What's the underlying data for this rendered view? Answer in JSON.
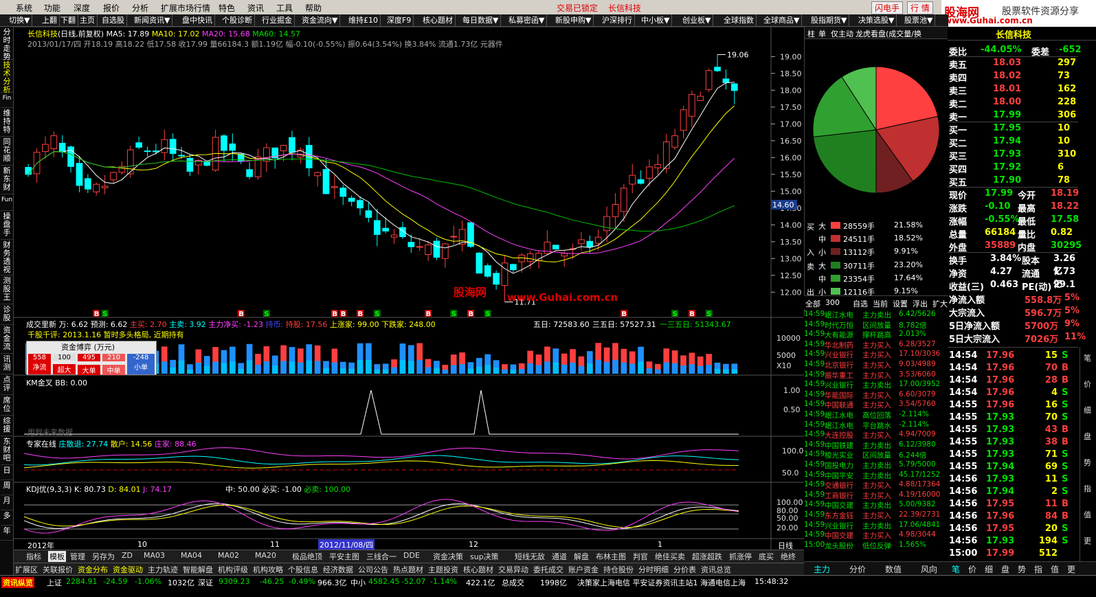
{
  "menu": [
    "系统",
    "功能",
    "深度",
    "报价",
    "分析",
    "扩展市场行情",
    "特色",
    "资讯",
    "工具",
    "帮助"
  ],
  "menu_status": "交易已锁定",
  "menu_stock": "长信科技",
  "menu_right": [
    "闪电手",
    "行 情"
  ],
  "logo": {
    "name": "股海网",
    "slogan": "股票软件资源分享",
    "url": "www.Guhai.com.cn"
  },
  "toolbar": [
    "切换▼",
    "上翻",
    "下翻",
    "主页",
    "自选股",
    "新闻资讯▼",
    "盘中快讯",
    "个股诊断",
    "行业掘金",
    "资金流向▼",
    "维持£10",
    "深度F9",
    "核心题材",
    "每日数据▼",
    "私募密函▼",
    "新股申购▼",
    "沪深排行",
    "中小板▼",
    "创业板▼",
    "全球指数",
    "全球商品▼",
    "股指期货▼",
    "决策选股▼",
    "股票池▼"
  ],
  "left_tabs": [
    "分时走势",
    "技术分析",
    "维持特",
    "同花顺",
    "新东财",
    "操盘手",
    "财务透视",
    "测股王",
    "诊股",
    "资金流",
    "讯测",
    "点评",
    "席位",
    "综援",
    "东财吧",
    "日",
    "周",
    "月",
    "多",
    "年"
  ],
  "left_icons": [
    "Fin",
    "Fun",
    "Fiz",
    "RSI"
  ],
  "chart_header": {
    "name": "长信科技",
    "period": "(日线,前复权)",
    "ma5": "MA5: 17.89",
    "ma10": "MA10: 17.02",
    "ma20": "MA20: 15.68",
    "ma60": "MA60: 14.57",
    "info": "2013/01/17/四  开18.19  高18.22  低17.58  收17.99  量66184.3  额1.19亿  幅-0.10(-0.55%)  振0.64(3.54%)  换3.84%  流通1.73亿  元器件"
  },
  "price_axis": [
    "19.00",
    "18.50",
    "18.00",
    "17.50",
    "17.00",
    "16.50",
    "16.00",
    "15.50",
    "15.00",
    "14.50",
    "14.00",
    "13.50",
    "13.00",
    "12.50",
    "12.00"
  ],
  "price_high": "19.06",
  "price_low": "11.71",
  "cursor_price": "14.60",
  "watermark": {
    "site": "股海网",
    "url": "www.Guhai.com.cn"
  },
  "volume_header": {
    "label": "成交里新 万: 6.62",
    "yc": "预测: 6.62",
    "zj": "主买: 2.70",
    "zm": "主卖: 3.92",
    "zl": "主力净买: -1.23",
    "sh": "持币:",
    "cg": "持股: 17.56",
    "up": "上涨家: 99.00",
    "dn": "下跌家: 248.00",
    "d5": "五日: 72583.60",
    "d35": "三五日: 57527.31",
    "d135": "一三五日: 51343.67"
  },
  "comment": "千股千评: 2013.1.16 暂时多头格局, 近期持有",
  "fund_box": {
    "title": "资金博弈 (万元)",
    "values": [
      "558",
      "100",
      "495",
      "210",
      "-248"
    ],
    "labels": [
      "净流",
      "超大",
      "大单",
      "中单",
      "小单"
    ]
  },
  "volume_axis": [
    "10000",
    "5000",
    "X10"
  ],
  "km": {
    "label": "KM金叉  BB: 0.00",
    "axis": [
      "1.00",
      "0.50"
    ],
    "note": "用到未来数据"
  },
  "expert": {
    "label": "专家在线",
    "zs": "庄散退: 27.74",
    "sh": "散户: 14.56",
    "zj": "庄家: 88.46",
    "axis": [
      "100.0",
      "50.0"
    ]
  },
  "kdj": {
    "label": "KDJ优(9,3,3)",
    "k": "K: 80.73",
    "d": "D: 84.01",
    "j": "J: 74.17",
    "zh": "中: 50.00",
    "bm": "必买: -1.00",
    "bx": "必卖: 100.00",
    "axis": [
      "100.00",
      "80.00",
      "50.00",
      "20.00"
    ]
  },
  "date_axis": [
    "2012年",
    "10",
    "11",
    "2012/11/08/四",
    "12",
    "1"
  ],
  "axis_period": "日线",
  "bottom_tabs": [
    "指标",
    "模板",
    "管理",
    "另存为",
    "ZD",
    "MA03",
    "MA04",
    "MA02",
    "MA20",
    "极品绝顶",
    "平安主图",
    "三线合一",
    "DDE",
    "资金决策",
    "sup决策",
    "短线无敌",
    "通道",
    "解盘",
    "布林主图",
    "判官",
    "绝佳买卖",
    "超涨超跌",
    "抓涨停",
    "底买",
    "绝终"
  ],
  "bottom_tabs2": [
    "扩展区",
    "关联报价",
    "资金分布",
    "资金驱动",
    "主力轨迹",
    "智能解盘",
    "机构评级",
    "机构攻略",
    "个股信息",
    "经济数据",
    "公司公告",
    "热点题材",
    "主题投资",
    "核心题材",
    "交易异动",
    "委托成交",
    "账户资金",
    "持仓股份",
    "分时明细",
    "分价表",
    "资讯总览"
  ],
  "pie": {
    "tabs": [
      "柱",
      "单",
      "仅主动",
      "龙虎看盘(成交量/换"
    ],
    "buy": [
      {
        "lab": "大",
        "vol": "28559手",
        "pct": "21.58%"
      },
      {
        "lab": "中",
        "vol": "24511手",
        "pct": "18.52%"
      },
      {
        "lab": "小",
        "vol": "13112手",
        "pct": "9.91%"
      }
    ],
    "sell": [
      {
        "lab": "大",
        "vol": "30711手",
        "pct": "23.20%"
      },
      {
        "lab": "中",
        "vol": "23354手",
        "pct": "17.64%"
      },
      {
        "lab": "小",
        "vol": "12116手",
        "pct": "9.15%"
      }
    ],
    "side_buy": [
      "买",
      "入"
    ],
    "side_sell": [
      "卖",
      "出"
    ],
    "slices": [
      21.58,
      18.52,
      9.91,
      23.2,
      17.64,
      9.15
    ]
  },
  "news_tabs": [
    "全部",
    "300",
    "自选",
    "当前",
    "设置",
    "浮出",
    "扩大"
  ],
  "news": [
    [
      "14:59",
      "岷江水电",
      "主力卖出",
      "6.42/5626"
    ],
    [
      "14:59",
      "时代万恒",
      "区间放量",
      "8.782倍"
    ],
    [
      "14:59",
      "大有能源",
      "撑杆跳高",
      "2.013%"
    ],
    [
      "14:59",
      "华北制药",
      "主力买入",
      "6.28/3527"
    ],
    [
      "14:59",
      "兴业银行",
      "主力买入",
      "17.10/3036"
    ],
    [
      "14:59",
      "北京银行",
      "主力买入",
      "9.03/4989"
    ],
    [
      "14:59",
      "振华重工",
      "主力买入",
      "3.53/6060"
    ],
    [
      "14:59",
      "兴业银行",
      "主力卖出",
      "17.00/3952"
    ],
    [
      "14:59",
      "华能国际",
      "主力买入",
      "6.60/3079"
    ],
    [
      "14:59",
      "中国联通",
      "主力买入",
      "3.54/5760"
    ],
    [
      "14:59",
      "岷江水电",
      "高位回落",
      "-2.114%"
    ],
    [
      "14:59",
      "岷江水电",
      "平台跳水",
      "-2.114%"
    ],
    [
      "14:59",
      "大连控股",
      "主力买入",
      "4.94/7009"
    ],
    [
      "14:59",
      "中国铁建",
      "主力卖出",
      "6.12/3980"
    ],
    [
      "14:59",
      "梭光实业",
      "区间放量",
      "6.244倍"
    ],
    [
      "14:59",
      "国投电力",
      "主力卖出",
      "5.79/5000"
    ],
    [
      "14:59",
      "中国平安",
      "主力卖出",
      "45.17/1252"
    ],
    [
      "14:59",
      "交通银行",
      "主力买入",
      "4.88/17364"
    ],
    [
      "14:59",
      "工商银行",
      "主力买入",
      "4.19/16000"
    ],
    [
      "14:59",
      "中国交建",
      "主力卖出",
      "5.00/9382"
    ],
    [
      "14:59",
      "东方金钰",
      "主力买入",
      "22.39/2731"
    ],
    [
      "14:59",
      "兴业银行",
      "主力卖出",
      "17.06/4841"
    ],
    [
      "14:59",
      "中国交建",
      "主力买入",
      "4.98/3044"
    ],
    [
      "15:00",
      "龙头股份",
      "低位反弹",
      "1.565%"
    ]
  ],
  "right_bottom_tabs": [
    "主力",
    "分价",
    "数值",
    "风向"
  ],
  "quote_header": "长信科技",
  "quote": {
    "wb": [
      "委比",
      "-44.05%",
      "委差",
      "-652"
    ],
    "sell": [
      [
        "卖五",
        "18.03",
        "297"
      ],
      [
        "卖四",
        "18.02",
        "73"
      ],
      [
        "卖三",
        "18.01",
        "162"
      ],
      [
        "卖二",
        "18.00",
        "228"
      ],
      [
        "卖一",
        "17.99",
        "306"
      ]
    ],
    "buy": [
      [
        "买一",
        "17.95",
        "10"
      ],
      [
        "买二",
        "17.94",
        "10"
      ],
      [
        "买三",
        "17.93",
        "310"
      ],
      [
        "买四",
        "17.92",
        "6"
      ],
      [
        "买五",
        "17.90",
        "78"
      ]
    ],
    "stats": [
      [
        "现价",
        "17.99",
        "今开",
        "18.19"
      ],
      [
        "涨跌",
        "-0.10",
        "最高",
        "18.22"
      ],
      [
        "涨幅",
        "-0.55%",
        "最低",
        "17.58"
      ],
      [
        "总量",
        "66184",
        "量比",
        "0.82"
      ],
      [
        "外盘",
        "35889",
        "内盘",
        "30295"
      ]
    ],
    "stats2": [
      [
        "换手",
        "3.84%",
        "股本",
        "3.26亿"
      ],
      [
        "净资",
        "4.27",
        "流通",
        "1.73亿"
      ],
      [
        "收益(三)",
        "0.463",
        "PE(动)",
        "29.1"
      ]
    ],
    "flow": [
      [
        "净流入额",
        "558.8万",
        "5%"
      ],
      [
        "大宗流入",
        "596.7万",
        "5%"
      ],
      [
        "5日净流入额",
        "5700万",
        "9%"
      ],
      [
        "5日大宗流入",
        "7026万",
        "11%"
      ]
    ]
  },
  "ticks": [
    [
      "14:54",
      "17.96",
      "15",
      "S"
    ],
    [
      "14:54",
      "17.96",
      "70",
      "B"
    ],
    [
      "14:54",
      "17.96",
      "28",
      "B"
    ],
    [
      "14:54",
      "17.96",
      "4",
      "S"
    ],
    [
      "14:55",
      "17.96",
      "16",
      "S"
    ],
    [
      "14:55",
      "17.93",
      "70",
      "S"
    ],
    [
      "14:55",
      "17.93",
      "43",
      "B"
    ],
    [
      "14:55",
      "17.93",
      "38",
      "B"
    ],
    [
      "14:55",
      "17.93",
      "71",
      "S"
    ],
    [
      "14:55",
      "17.94",
      "69",
      "S"
    ],
    [
      "14:56",
      "17.93",
      "11",
      "S"
    ],
    [
      "14:56",
      "17.94",
      "2",
      "S"
    ],
    [
      "14:56",
      "17.95",
      "11",
      "B"
    ],
    [
      "14:56",
      "17.96",
      "84",
      "B"
    ],
    [
      "14:56",
      "17.95",
      "20",
      "S"
    ],
    [
      "14:56",
      "17.93",
      "194",
      "S"
    ],
    [
      "15:00",
      "17.99",
      "512",
      ""
    ]
  ],
  "right_edge_tabs": [
    "笔",
    "价",
    "细",
    "盘",
    "势",
    "指",
    "值",
    "更"
  ],
  "status": {
    "brand": "资讯纵览",
    "sh": "上证",
    "sh_val": "2284.91",
    "sh_chg": "-24.59",
    "sh_pct": "-1.06%",
    "sh_amt": "1032亿",
    "sz": "深证",
    "sz_val": "9309.23",
    "sz_chg": "-46.25",
    "sz_pct": "-0.49%",
    "sz_amt": "966.3亿",
    "zx": "中小",
    "zx_val": "4582.45",
    "zx_chg": "-52.07",
    "zx_pct": "-1.14%",
    "zx_amt": "422.1亿",
    "total": "总成交",
    "total_amt": "1998亿",
    "ticker": "决策家上海电信  平安证券资讯主站1  海通电信上海",
    "time": "15:48:32"
  },
  "colors": {
    "up": "#ff3f3f",
    "down": "#00ffff",
    "ma5": "#ffffff",
    "ma10": "#ffff00",
    "ma20": "#ff40ff",
    "ma60": "#00c000"
  }
}
